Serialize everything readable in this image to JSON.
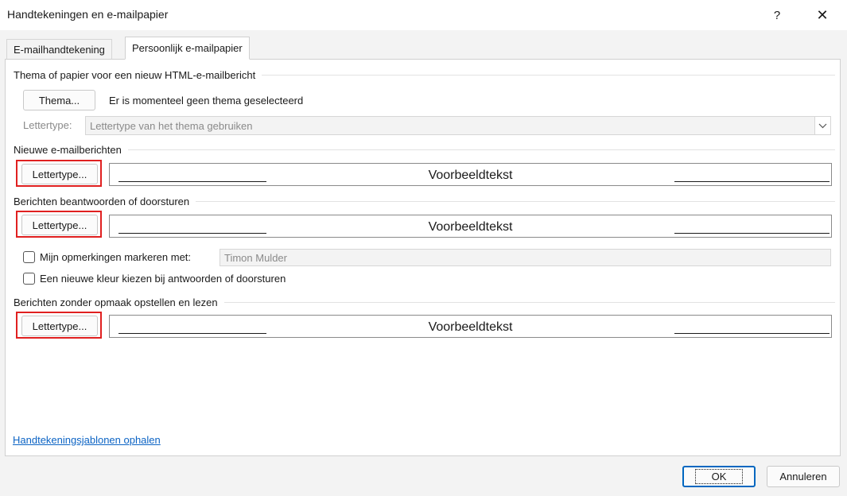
{
  "window": {
    "title": "Handtekeningen en e-mailpapier",
    "help_glyph": "?",
    "close_glyph": "✕"
  },
  "tabs": [
    {
      "label": "E-mailhandtekening"
    },
    {
      "label": "Persoonlijk e-mailpapier",
      "selected": true
    }
  ],
  "theme": {
    "section_label": "Thema of papier voor een nieuw HTML-e-mailbericht",
    "button_label": "Thema...",
    "status": "Er is momenteel geen thema geselecteerd",
    "font_label": "Lettertype:",
    "font_value": "Lettertype van het thema gebruiken"
  },
  "new_messages": {
    "section_label": "Nieuwe e-mailberichten",
    "button_label": "Lettertype...",
    "preview_text": "Voorbeeldtekst"
  },
  "replies": {
    "section_label": "Berichten beantwoorden of doorsturen",
    "button_label": "Lettertype...",
    "preview_text": "Voorbeeldtekst",
    "mark_comments_label": "Mijn opmerkingen markeren met:",
    "mark_comments_value": "Timon Mulder",
    "mark_comments_checked": false,
    "new_color_label": "Een nieuwe kleur kiezen bij antwoorden of doorsturen",
    "new_color_checked": false
  },
  "plain_text": {
    "section_label": "Berichten zonder opmaak opstellen en lezen",
    "button_label": "Lettertype...",
    "preview_text": "Voorbeeldtekst"
  },
  "link_templates": "Handtekeningsjablonen ophalen",
  "footer": {
    "ok_label": "OK",
    "cancel_label": "Annuleren"
  },
  "colors": {
    "highlight": "#e02020",
    "link": "#0b63c4",
    "focus": "#0067c0"
  }
}
